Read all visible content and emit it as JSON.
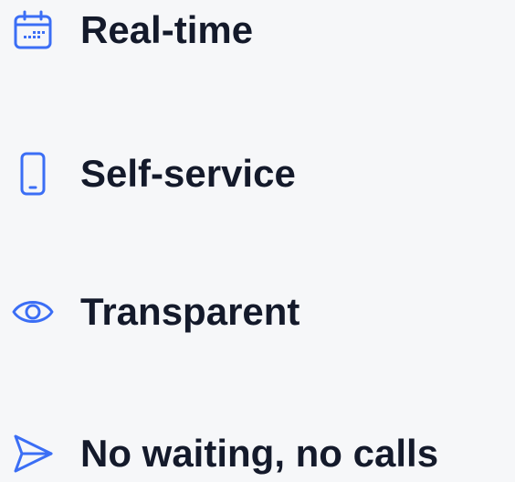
{
  "accent_color": "#3b6ef5",
  "text_color": "#141a2b",
  "features": [
    {
      "icon": "calendar-icon",
      "label": "Real-time"
    },
    {
      "icon": "smartphone-icon",
      "label": "Self-service"
    },
    {
      "icon": "eye-icon",
      "label": "Transparent"
    },
    {
      "icon": "send-icon",
      "label": "No waiting, no calls"
    }
  ]
}
